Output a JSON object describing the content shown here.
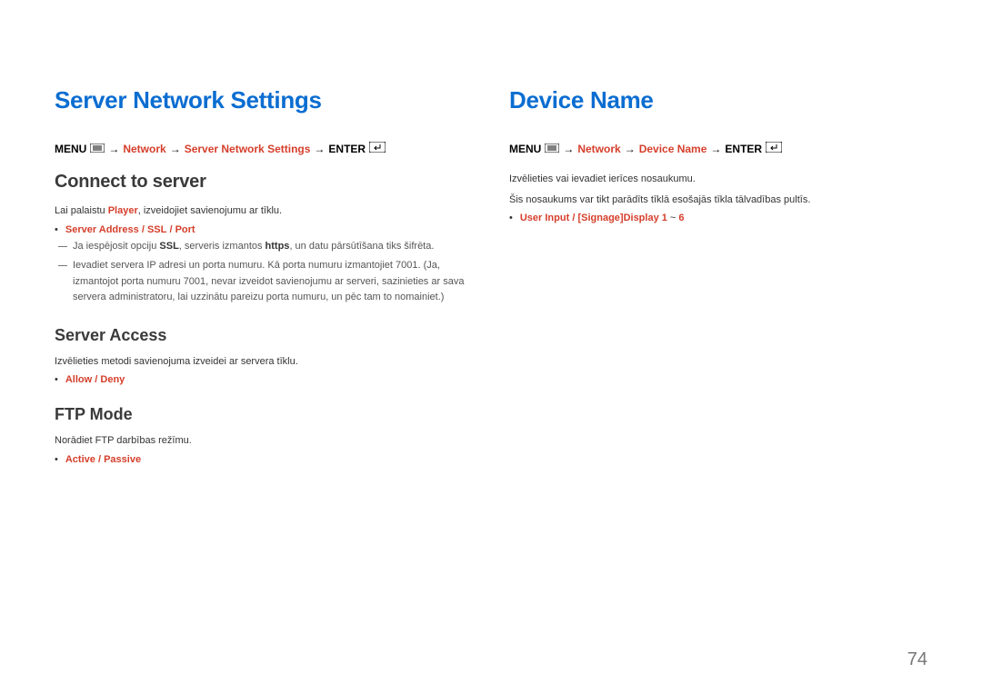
{
  "page_number": "74",
  "left": {
    "h1": "Server Network Settings",
    "menu": {
      "menu_label": "MENU",
      "arrow": "→",
      "network": "Network",
      "item": "Server Network Settings",
      "enter_label": "ENTER"
    },
    "connect": {
      "title": "Connect to server",
      "p1_a": "Lai palaistu ",
      "p1_b": "Player",
      "p1_c": ", izveidojiet savienojumu ar tīklu.",
      "opts": [
        "Server Address",
        "SSL",
        "Port"
      ],
      "dash1_a": "Ja iespējosit opciju ",
      "dash1_b": "SSL",
      "dash1_c": ", serveris izmantos ",
      "dash1_d": "https",
      "dash1_e": ", un datu pārsūtīšana tiks šifrēta.",
      "dash2": "Ievadiet servera IP adresi un porta numuru. Kā porta numuru izmantojiet 7001. (Ja, izmantojot porta numuru 7001, nevar izveidot savienojumu ar serveri, sazinieties ar sava servera administratoru, lai uzzinātu pareizu porta numuru, un pēc tam to nomainiet.)"
    },
    "access": {
      "title": "Server Access",
      "p1": "Izvēlieties metodi savienojuma izveidei ar servera tīklu.",
      "opts": [
        "Allow",
        "Deny"
      ]
    },
    "ftp": {
      "title": "FTP Mode",
      "p1": "Norādiet FTP darbības režīmu.",
      "opts": [
        "Active",
        "Passive"
      ]
    }
  },
  "right": {
    "h1": "Device Name",
    "menu": {
      "menu_label": "MENU",
      "arrow": "→",
      "network": "Network",
      "item": "Device Name",
      "enter_label": "ENTER"
    },
    "p1": "Izvēlieties vai ievadiet ierīces nosaukumu.",
    "p2": "Šis nosaukums var tikt parādīts tīklā esošajās tīkla tālvadības pultīs.",
    "opt1": "User Input",
    "opt2_prefix": "[Signage]Display 1",
    "opt2_sep": " ~ ",
    "opt2_suffix": "6"
  }
}
